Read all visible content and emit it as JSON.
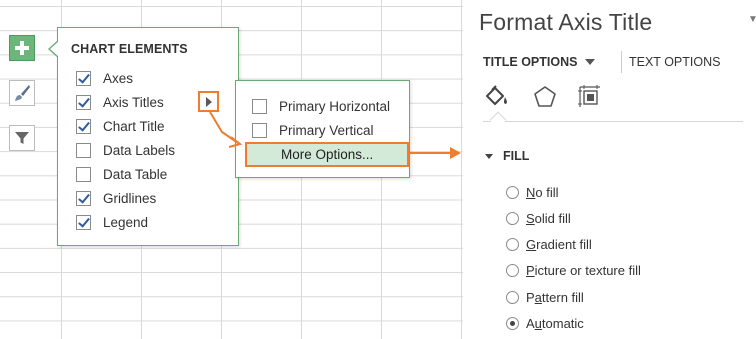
{
  "chart_buttons": [
    {
      "name": "chart-elements-button",
      "icon": "plus-icon",
      "active": true
    },
    {
      "name": "chart-styles-button",
      "icon": "paintbrush-icon",
      "active": false
    },
    {
      "name": "chart-filters-button",
      "icon": "funnel-icon",
      "active": false
    }
  ],
  "chart_elements": {
    "title": "CHART ELEMENTS",
    "items": [
      {
        "label": "Axes",
        "checked": true
      },
      {
        "label": "Axis Titles",
        "checked": true
      },
      {
        "label": "Chart Title",
        "checked": true
      },
      {
        "label": "Data Labels",
        "checked": false
      },
      {
        "label": "Data Table",
        "checked": false
      },
      {
        "label": "Gridlines",
        "checked": true
      },
      {
        "label": "Legend",
        "checked": true
      }
    ],
    "expand_icon": "triangle-right-icon"
  },
  "axis_titles_menu": {
    "items": [
      {
        "label": "Primary Horizontal",
        "checked": false
      },
      {
        "label": "Primary Vertical",
        "checked": false
      }
    ],
    "more_options": "More Options..."
  },
  "pane": {
    "title": "Format Axis Title",
    "tab_active": "TITLE OPTIONS",
    "tab_other": "TEXT OPTIONS",
    "icons": [
      "fill-line-icon",
      "effects-pentagon-icon",
      "size-properties-icon"
    ],
    "section": "FILL",
    "fill_options": [
      {
        "prefix": "",
        "accel": "N",
        "rest": "o fill",
        "selected": false
      },
      {
        "prefix": "",
        "accel": "S",
        "rest": "olid fill",
        "selected": false
      },
      {
        "prefix": "",
        "accel": "G",
        "rest": "radient fill",
        "selected": false
      },
      {
        "prefix": "",
        "accel": "P",
        "rest": "icture or texture fill",
        "selected": false
      },
      {
        "prefix": "P",
        "accel": "a",
        "rest": "ttern fill",
        "selected": false
      },
      {
        "prefix": "A",
        "accel": "u",
        "rest": "tomatic",
        "selected": true
      }
    ]
  },
  "colors": {
    "accent_orange": "#ed7d31",
    "menu_border_green": "#6aab73",
    "highlight_green": "#d4ead8",
    "checkmark_blue": "#2f5d9b"
  }
}
